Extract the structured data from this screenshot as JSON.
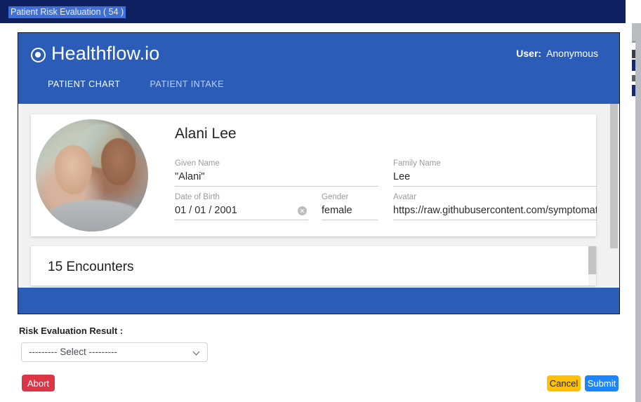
{
  "window": {
    "selected_tab_title": "Patient Risk Evaluation ( 54 )"
  },
  "app": {
    "brand": "Healthflow.io",
    "logo_icon": "target-dot-icon",
    "user": {
      "label": "User:",
      "value": "Anonymous"
    },
    "tabs": [
      {
        "label": "PATIENT CHART",
        "active": true
      },
      {
        "label": "PATIENT INTAKE",
        "active": false
      }
    ],
    "patient": {
      "name": "Alani Lee",
      "avatar_alt": "patient-photo",
      "fields": [
        {
          "label": "Given Name",
          "value": "\"Alani\""
        },
        {
          "label": "Family Name",
          "value": "Lee"
        },
        {
          "label": "Date of Birth",
          "value": "01 / 01 / 2001",
          "clearable": true
        },
        {
          "label": "Gender",
          "value": "female"
        },
        {
          "label": "Avatar",
          "value": "https://raw.githubusercontent.com/symptomatic/him"
        }
      ]
    },
    "encounters": {
      "title": "15 Encounters"
    }
  },
  "form": {
    "risk_label": "Risk Evaluation Result :",
    "select_value": "--------- Select ---------",
    "abort_label": "Abort",
    "cancel_label": "Cancel",
    "submit_label": "Submit"
  },
  "colors": {
    "topbar": "#0f2060",
    "selection": "#3f6fd8",
    "app_blue": "#2b5cb8",
    "abort_red": "#dc3545",
    "cancel_yellow": "#ffc107",
    "submit_blue": "#1a85ff"
  }
}
